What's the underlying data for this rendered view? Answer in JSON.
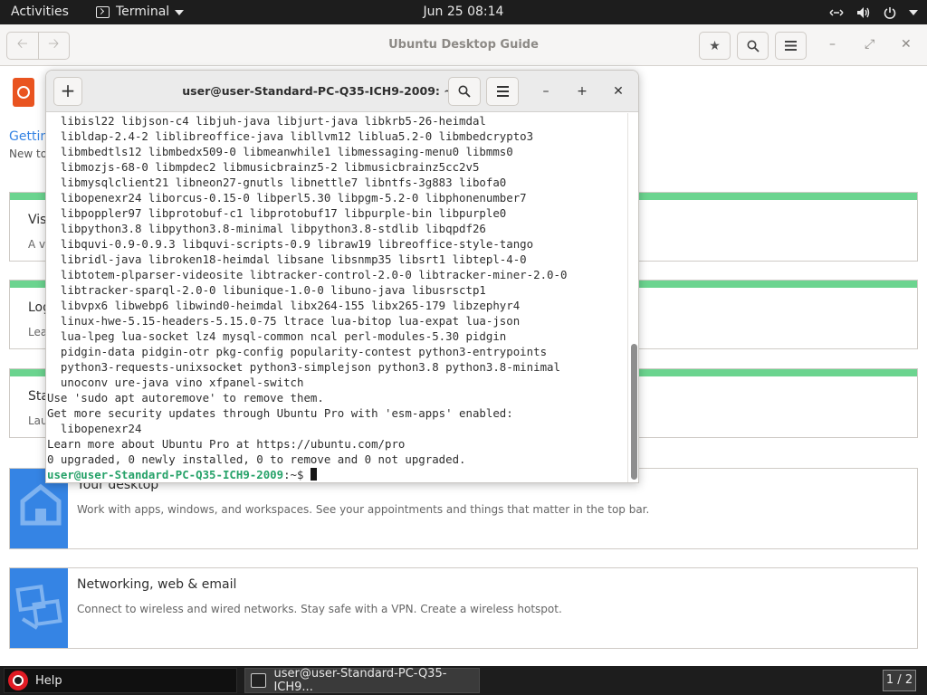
{
  "topbar": {
    "activities": "Activities",
    "app_name": "Terminal",
    "clock": "Jun 25  08:14"
  },
  "help_window": {
    "title": "Ubuntu Desktop Guide",
    "breadcrumb_link": "Gettin",
    "breadcrumb_sub": "New to",
    "cards": [
      {
        "title": "Vis",
        "desc": "A v"
      },
      {
        "title": "Log",
        "desc": "Lea"
      },
      {
        "title": "Sta",
        "desc": "Lau"
      }
    ],
    "icon_cards": [
      {
        "title": "Your desktop",
        "desc": "Work with apps, windows, and workspaces. See your appointments and things that matter in the top bar.",
        "icon": "desktop-home-icon"
      },
      {
        "title": "Networking, web & email",
        "desc": "Connect to wireless and wired networks. Stay safe with a VPN. Create a wireless hotspot.",
        "icon": "network-icon"
      }
    ]
  },
  "terminal": {
    "title": "user@user-Standard-PC-Q35-ICH9-2009: ~",
    "lines": [
      "  libisl22 libjson-c4 libjuh-java libjurt-java libkrb5-26-heimdal",
      "  libldap-2.4-2 liblibreoffice-java libllvm12 liblua5.2-0 libmbedcrypto3",
      "  libmbedtls12 libmbedx509-0 libmeanwhile1 libmessaging-menu0 libmms0",
      "  libmozjs-68-0 libmpdec2 libmusicbrainz5-2 libmusicbrainz5cc2v5",
      "  libmysqlclient21 libneon27-gnutls libnettle7 libntfs-3g883 libofa0",
      "  libopenexr24 liborcus-0.15-0 libperl5.30 libpgm-5.2-0 libphonenumber7",
      "  libpoppler97 libprotobuf-c1 libprotobuf17 libpurple-bin libpurple0",
      "  libpython3.8 libpython3.8-minimal libpython3.8-stdlib libqpdf26",
      "  libquvi-0.9-0.9.3 libquvi-scripts-0.9 libraw19 libreoffice-style-tango",
      "  libridl-java libroken18-heimdal libsane libsnmp35 libsrt1 libtepl-4-0",
      "  libtotem-plparser-videosite libtracker-control-2.0-0 libtracker-miner-2.0-0",
      "  libtracker-sparql-2.0-0 libunique-1.0-0 libuno-java libusrsctp1",
      "  libvpx6 libwebp6 libwind0-heimdal libx264-155 libx265-179 libzephyr4",
      "  linux-hwe-5.15-headers-5.15.0-75 ltrace lua-bitop lua-expat lua-json",
      "  lua-lpeg lua-socket lz4 mysql-common ncal perl-modules-5.30 pidgin",
      "  pidgin-data pidgin-otr pkg-config popularity-contest python3-entrypoints",
      "  python3-requests-unixsocket python3-simplejson python3.8 python3.8-minimal",
      "  unoconv ure-java vino xfpanel-switch",
      "Use 'sudo apt autoremove' to remove them.",
      "Get more security updates through Ubuntu Pro with 'esm-apps' enabled:",
      "  libopenexr24",
      "Learn more about Ubuntu Pro at https://ubuntu.com/pro",
      "0 upgraded, 0 newly installed, 0 to remove and 0 not upgraded."
    ],
    "prompt_user": "user@user-Standard-PC-Q35-ICH9-2009",
    "prompt_suffix": ":~$ "
  },
  "taskbar": {
    "help_label": "Help",
    "terminal_label": "user@user-Standard-PC-Q35-ICH9...",
    "workspace": "1 / 2"
  },
  "colors": {
    "accent_green": "#6bd48f",
    "prompt_green": "#26a269",
    "icon_blue": "#3584e4",
    "ubuntu_orange": "#e95420"
  }
}
